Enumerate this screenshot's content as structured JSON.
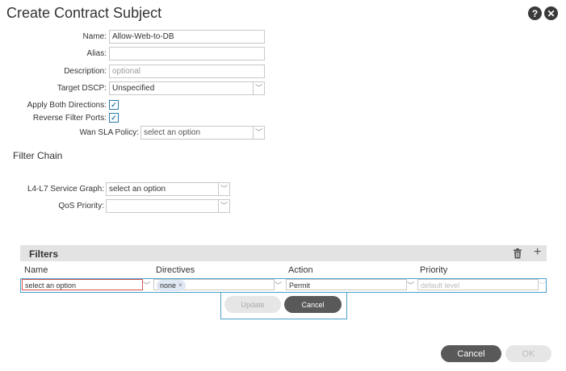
{
  "dialog": {
    "title": "Create Contract Subject"
  },
  "header_icons": {
    "help": "?",
    "close": "✕"
  },
  "form": {
    "name_label": "Name:",
    "name_value": "Allow-Web-to-DB",
    "alias_label": "Alias:",
    "alias_value": "",
    "description_label": "Description:",
    "description_placeholder": "optional",
    "target_dscp_label": "Target DSCP:",
    "target_dscp_value": "Unspecified",
    "apply_both_label": "Apply Both Directions:",
    "apply_both_checked": true,
    "reverse_ports_label": "Reverse Filter Ports:",
    "reverse_ports_checked": true,
    "wan_sla_label": "Wan SLA Policy:",
    "wan_sla_placeholder": "select an option"
  },
  "filter_chain": {
    "title": "Filter Chain",
    "service_graph_label": "L4-L7 Service Graph:",
    "service_graph_placeholder": "select an option",
    "qos_label": "QoS Priority:",
    "qos_value": ""
  },
  "filters": {
    "title": "Filters",
    "columns": [
      "Name",
      "Directives",
      "Action",
      "Priority"
    ],
    "row": {
      "name_placeholder": "select an option",
      "directive_chip": "none",
      "action_value": "Permit",
      "priority_placeholder": "default level"
    },
    "update_label": "Update",
    "cancel_label": "Cancel"
  },
  "footer": {
    "cancel_label": "Cancel",
    "ok_label": "OK"
  },
  "colors": {
    "accent": "#4aa0c8",
    "error": "#d9534f",
    "dark_button": "#595959"
  }
}
